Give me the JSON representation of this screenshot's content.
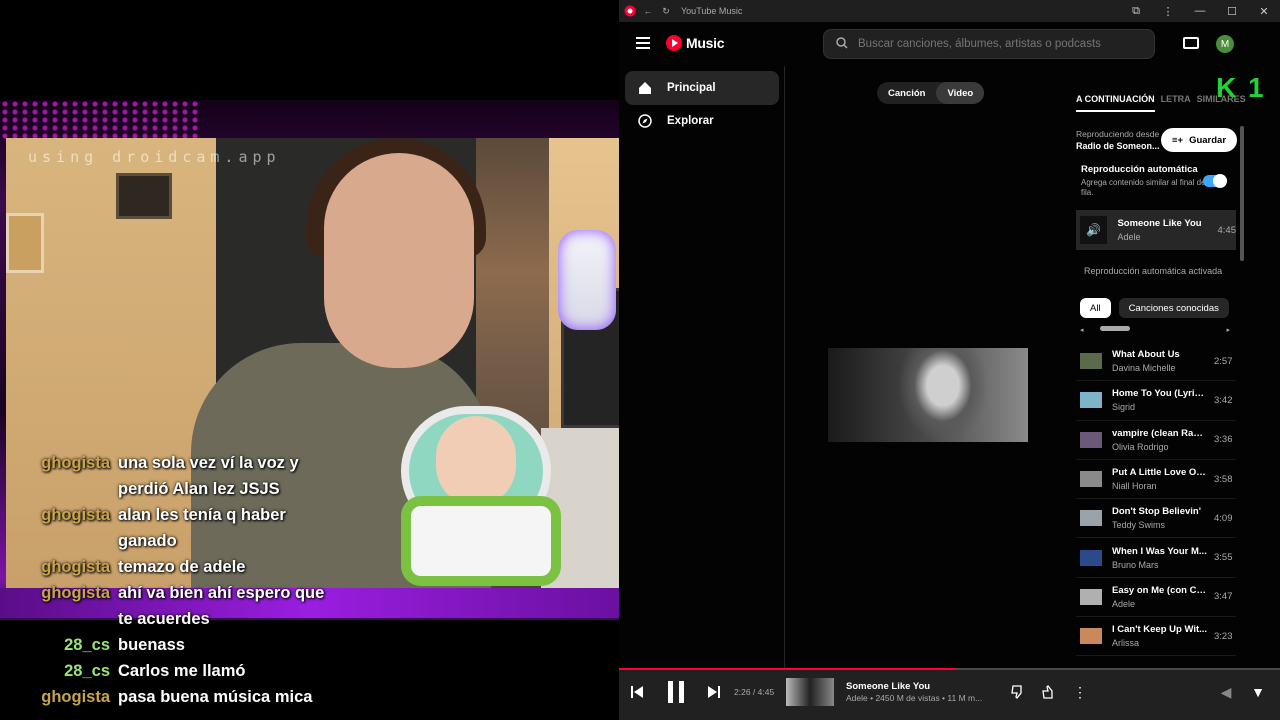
{
  "stream": {
    "watermark": "using droidcam.app",
    "chat": [
      {
        "user": "ghogista",
        "message": "una sola vez ví la voz y perdió Alan lez JSJS",
        "color": "#c8a44a"
      },
      {
        "user": "ghogista",
        "message": "alan les tenía q haber ganado",
        "color": "#c8a44a"
      },
      {
        "user": "ghogista",
        "message": "temazo de adele",
        "color": "#c8a44a"
      },
      {
        "user": "ghogista",
        "message": "ahí va bien ahí espero que te acuerdes",
        "color": "#c8a44a"
      },
      {
        "user": "28_cs",
        "message": "buenass",
        "color": "#9be37a"
      },
      {
        "user": "28_cs",
        "message": "Carlos me llamó",
        "color": "#9be37a"
      },
      {
        "user": "ghogista",
        "message": "pasa buena música mica",
        "color": "#c8a44a"
      }
    ]
  },
  "window": {
    "title": "YouTube Music"
  },
  "header": {
    "logo_text": "Music",
    "search_placeholder": "Buscar canciones, álbumes, artistas o podcasts",
    "avatar_letter": "M"
  },
  "sidebar": {
    "items": [
      {
        "label": "Principal",
        "icon": "home-icon",
        "active": true
      },
      {
        "label": "Explorar",
        "icon": "compass-icon",
        "active": false
      }
    ]
  },
  "player": {
    "toggle": [
      "Canción",
      "Video"
    ],
    "selected": "Video"
  },
  "queue": {
    "tabs": [
      "A CONTINUACIÓN",
      "LETRA",
      "SIMILARES"
    ],
    "overlay_logo": "K 1",
    "playing_from_label": "Reproduciendo desde",
    "playing_from_name": "Radio de Someon...",
    "save_label": "Guardar",
    "autoplay_title": "Reproducción automática",
    "autoplay_desc": "Agrega contenido similar al final de la fila.",
    "autoplay_on": true,
    "now": {
      "title": "Someone Like You",
      "artist": "Adele",
      "duration": "4:45"
    },
    "autoplay_active_label": "Reproducción automática activada",
    "chips": [
      "All",
      "Canciones conocidas"
    ],
    "items": [
      {
        "title": "What About Us",
        "artist": "Davina Michelle",
        "duration": "2:57",
        "thumb": "#5a6a4a"
      },
      {
        "title": "Home To You (Lyric ...",
        "artist": "Sigrid",
        "duration": "3:42",
        "thumb": "#7fb3c8"
      },
      {
        "title": "vampire (clean Radi...",
        "artist": "Olivia Rodrigo",
        "duration": "3:36",
        "thumb": "#6a5a78"
      },
      {
        "title": "Put A Little Love On...",
        "artist": "Niall Horan",
        "duration": "3:58",
        "thumb": "#8a8a8a"
      },
      {
        "title": "Don't Stop Believin'",
        "artist": "Teddy Swims",
        "duration": "4:09",
        "thumb": "#9aa2aa"
      },
      {
        "title": "When I Was Your M...",
        "artist": "Bruno Mars",
        "duration": "3:55",
        "thumb": "#2a4a8a"
      },
      {
        "title": "Easy on Me (con Ch...",
        "artist": "Adele",
        "duration": "3:47",
        "thumb": "#b0b0b0"
      },
      {
        "title": "I Can't Keep Up Wit...",
        "artist": "Arlissa",
        "duration": "3:23",
        "thumb": "#c88a5a"
      }
    ]
  },
  "playerbar": {
    "time": "2:26 / 4:45",
    "progress": 0.51,
    "title": "Someone Like You",
    "subtitle": "Adele • 2450 M de vistas • 11 M m..."
  }
}
